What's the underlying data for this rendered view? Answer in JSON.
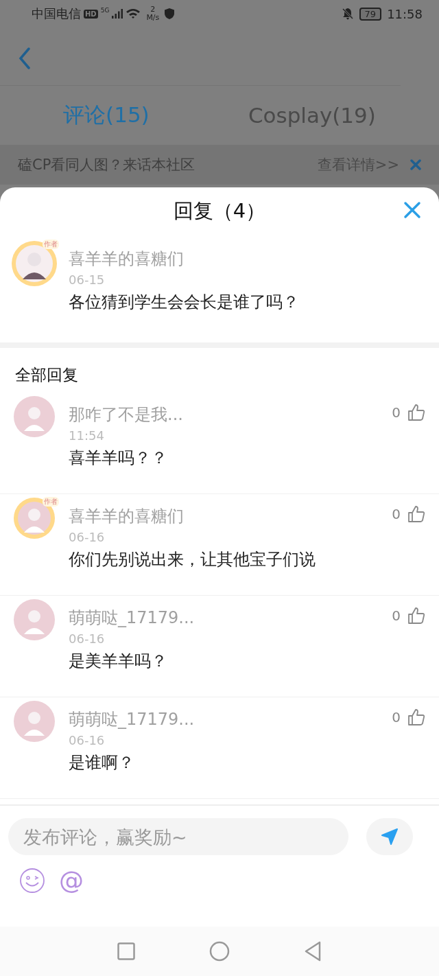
{
  "status_bar": {
    "carrier": "中国电信",
    "hd": "HD",
    "network": "5G",
    "speed_value": "2",
    "speed_unit": "M/s",
    "battery": "79",
    "time": "11:58"
  },
  "tabs": [
    {
      "label": "评论(15)",
      "selected": true
    },
    {
      "label": "Cosplay(19)",
      "selected": false
    }
  ],
  "banner": {
    "text": "磕CP看同人图？来话本社区",
    "link": "查看详情>>"
  },
  "sheet": {
    "title": "回复（4）",
    "post": {
      "author": "喜羊羊的喜糖们",
      "is_author": true,
      "author_badge": "作者",
      "date": "06-15",
      "content": "各位猜到学生会会长是谁了吗？"
    },
    "section_title": "全部回复",
    "replies": [
      {
        "author": "那咋了不是我...",
        "is_author": false,
        "date": "11:54",
        "content": "喜羊羊吗？？",
        "likes": "0"
      },
      {
        "author": "喜羊羊的喜糖们",
        "is_author": true,
        "author_badge": "作者",
        "date": "06-16",
        "content": "你们先别说出来，让其他宝子们说",
        "likes": "0"
      },
      {
        "author": "萌萌哒_17179...",
        "is_author": false,
        "date": "06-16",
        "content": "是美羊羊吗？",
        "likes": "0"
      },
      {
        "author": "萌萌哒_17179...",
        "is_author": false,
        "date": "06-16",
        "content": "是谁啊？",
        "likes": "0"
      }
    ],
    "input": {
      "placeholder": "发布评论，赢奖励~"
    },
    "mention": "@"
  }
}
